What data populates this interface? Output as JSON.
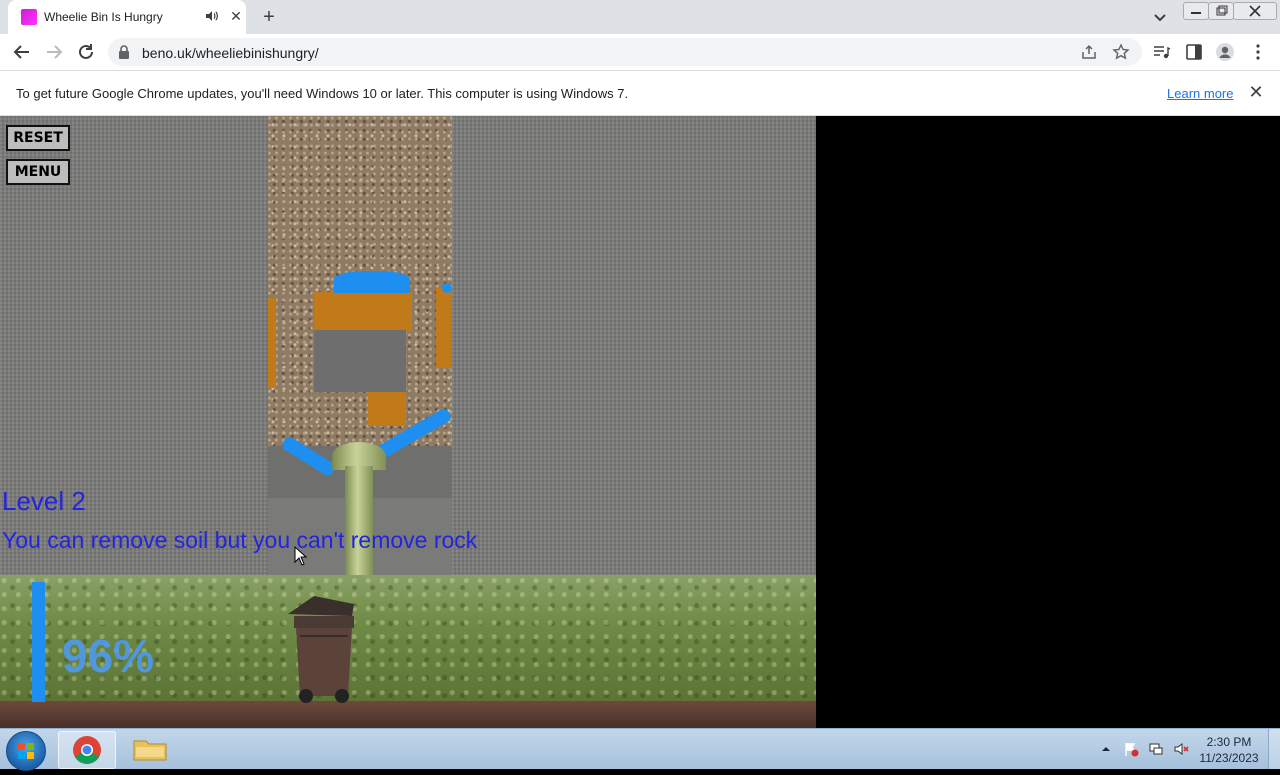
{
  "browser": {
    "tab_title": "Wheelie Bin Is Hungry",
    "url": "beno.uk/wheeliebinishungry/",
    "infobar": {
      "message": "To get future Google Chrome updates, you'll need Windows 10 or later. This computer is using Windows 7.",
      "link": "Learn more"
    }
  },
  "game": {
    "reset_label": "RESET",
    "menu_label": "MENU",
    "level_label": "Level 2",
    "hint": "You can remove soil but you can't remove rock",
    "fill_percent_label": "96%",
    "fill_level": 0.96,
    "colors": {
      "water": "#1e8ff0",
      "soil": "#c07a1a",
      "text": "#2424e0"
    }
  },
  "taskbar": {
    "time": "2:30 PM",
    "date": "11/23/2023"
  }
}
